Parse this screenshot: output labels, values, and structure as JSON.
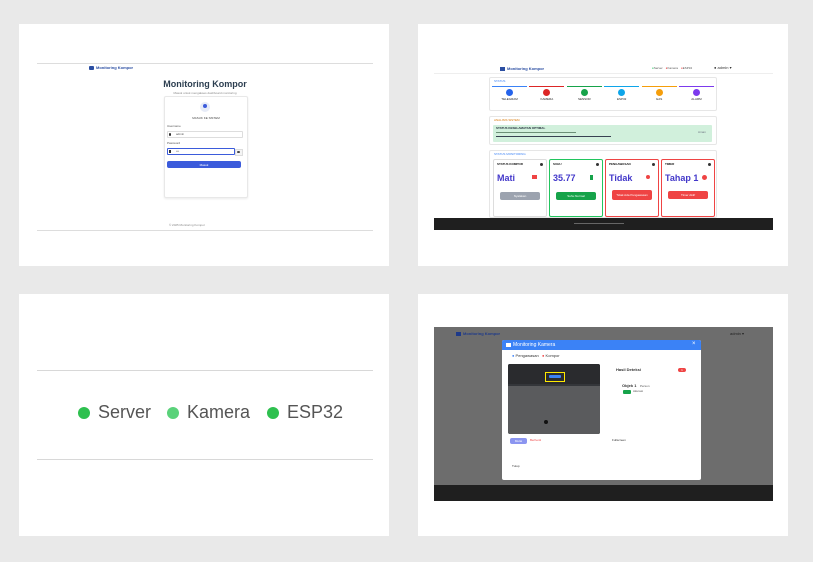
{
  "login": {
    "brand": "Monitoring Kompor",
    "title": "Monitoring Kompor",
    "subtitle": "Masuk untuk mengakses dashboard monitoring",
    "section_title": "MASUK KE SISTEM",
    "username_label": "Username",
    "username_value": "admin",
    "password_label": "Password",
    "password_value": "•••",
    "submit_label": "Masuk",
    "footer": "© 2025 Monitoring Kompor"
  },
  "dashboard": {
    "brand": "Monitoring Kompor",
    "nav_status": [
      "Server",
      "Kamera",
      "ESP32"
    ],
    "user": "admin",
    "status_section": "STATUS",
    "status_cards": [
      {
        "label": "TELEGRAM",
        "color": "#2563eb"
      },
      {
        "label": "KAMERA",
        "color": "#dc2626"
      },
      {
        "label": "SENSOR",
        "color": "#16a34a"
      },
      {
        "label": "ESP32",
        "color": "#0ea5e9"
      },
      {
        "label": "GAS",
        "color": "#f59e0b"
      },
      {
        "label": "ALARM",
        "color": "#7c3aed"
      }
    ],
    "analysis_section": "ANALISIS SISTEM",
    "analysis_title": "STATUS KESELAMATAN OPTIMAL",
    "analysis_badge": "Aman",
    "monitoring_section": "STATUS MONITORING",
    "tiles": [
      {
        "header": "STATUS KOMPOR",
        "value": "Mati",
        "value_color": "#4338ca",
        "border": "#dddddd",
        "button": "Nyalakan"
      },
      {
        "header": "SUHU",
        "value": "35.77",
        "value_color": "#4338ca",
        "border": "#22c55e",
        "button": "Suhu Normal"
      },
      {
        "header": "PENGAWASAN",
        "value": "Tidak",
        "value_color": "#4338ca",
        "border": "#ef4444",
        "button": "Tidak Ada Pengawasan"
      },
      {
        "header": "TIMER",
        "value": "Tahap 1",
        "value_color": "#4338ca",
        "border": "#ef4444",
        "button": "Timer Aktif"
      }
    ]
  },
  "status_bar": {
    "items": [
      {
        "label": "Server",
        "color": "#2ec04f"
      },
      {
        "label": "Kamera",
        "color": "#5ad27a"
      },
      {
        "label": "ESP32",
        "color": "#2ec04f"
      }
    ]
  },
  "camera": {
    "title": "Monitoring Kamera",
    "tab_1": "Pengawasan",
    "tab_2": "Kompor",
    "result_title": "Hasil Deteksi",
    "result_count": "1",
    "obj_label": "Objek 1",
    "obj_class": "Person",
    "obj_conf": "Akurasi",
    "start_label": "Mulai",
    "stop_label": "Berhenti",
    "fullscreen_label": "Fullscreen",
    "close_label": "Tutup",
    "bg_brand": "Monitoring Kompor",
    "bg_user": "admin"
  }
}
